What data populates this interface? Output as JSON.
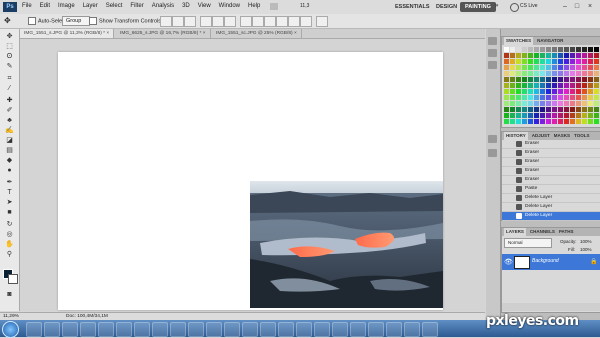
{
  "menubar": {
    "logo": "Ps",
    "items": [
      "File",
      "Edit",
      "Image",
      "Layer",
      "Select",
      "Filter",
      "Analysis",
      "3D",
      "View",
      "Window",
      "Help"
    ],
    "zoom": "11,3",
    "workspaces": [
      "ESSENTIALS",
      "DESIGN",
      "PAINTING"
    ],
    "active_workspace": "PAINTING",
    "cs_live": "CS Live"
  },
  "options": {
    "auto_select_label": "Auto-Select:",
    "auto_select_value": "Group",
    "transform_label": "Show Transform Controls"
  },
  "tabs": [
    "IMG_1551_s.JPG @ 11,3% (RGB/8) *",
    "IMG_6625_s.JPG @ 16,7% (RGB/8) *",
    "IMG_1551_sc.JPG @ 25% (RGB/8)"
  ],
  "status": {
    "zoom": "11,29%",
    "doc": "Doc: 100,4M/34,1M"
  },
  "panels": {
    "swatches_tabs": [
      "SWATCHES",
      "NAVIGATOR"
    ],
    "history_tabs": [
      "HISTORY",
      "ADJUST",
      "MASKS",
      "TOOLS"
    ],
    "history_items": [
      "Eraser",
      "Eraser",
      "Eraser",
      "Eraser",
      "Eraser",
      "Paste",
      "Delete Layer",
      "Delete Layer",
      "Delete Layer"
    ],
    "layers_tabs": [
      "LAYERS",
      "CHANNELS",
      "PATHS"
    ],
    "blend_mode": "Normal",
    "opacity_label": "Opacity:",
    "opacity_value": "100%",
    "fill_label": "Fill:",
    "fill_value": "100%",
    "layer_name": "Background"
  },
  "watermark": "pxleyes.com",
  "colors": {
    "accent": "#3d78d8",
    "taskbar": "#2d5a92"
  }
}
